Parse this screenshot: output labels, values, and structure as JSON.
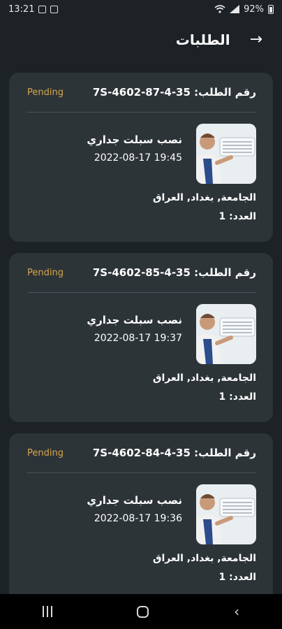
{
  "status_bar": {
    "time": "13:21",
    "battery": "92%"
  },
  "header": {
    "title": "الطلبات"
  },
  "orders": [
    {
      "number": "رقم الطلب: 7S-4602-87-4-35",
      "status": "Pending",
      "service": "نصب سبلت جداري",
      "datetime": "2022-08-17 19:45",
      "address": "الجامعة, بغداد, العراق",
      "count": "العدد: 1"
    },
    {
      "number": "رقم الطلب: 7S-4602-85-4-35",
      "status": "Pending",
      "service": "نصب سبلت جداري",
      "datetime": "2022-08-17 19:37",
      "address": "الجامعة, بغداد, العراق",
      "count": "العدد: 1"
    },
    {
      "number": "رقم الطلب: 7S-4602-84-4-35",
      "status": "Pending",
      "service": "نصب سبلت جداري",
      "datetime": "2022-08-17 19:36",
      "address": "الجامعة, بغداد, العراق",
      "count": "العدد: 1"
    }
  ],
  "colors": {
    "background": "#1c2226",
    "card": "#2d3438",
    "status_pending": "#d5a64b"
  }
}
